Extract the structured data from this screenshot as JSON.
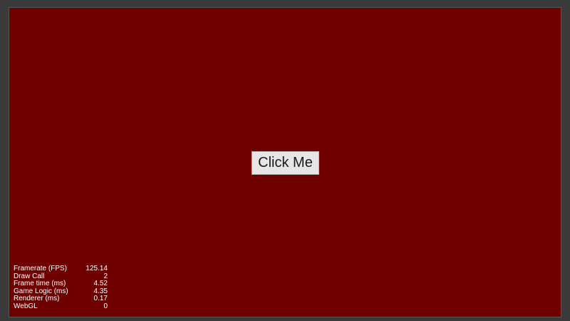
{
  "canvas": {
    "background_color": "#6f0000",
    "outer_background_color": "#3a3a3a"
  },
  "button": {
    "label": "Click Me"
  },
  "stats": [
    {
      "label": "Framerate (FPS)",
      "value": "125.14"
    },
    {
      "label": "Draw Call",
      "value": "2"
    },
    {
      "label": "Frame time (ms)",
      "value": "4.52"
    },
    {
      "label": "Game Logic (ms)",
      "value": "4.35"
    },
    {
      "label": "Renderer (ms)",
      "value": "0.17"
    },
    {
      "label": "WebGL",
      "value": "0"
    }
  ]
}
